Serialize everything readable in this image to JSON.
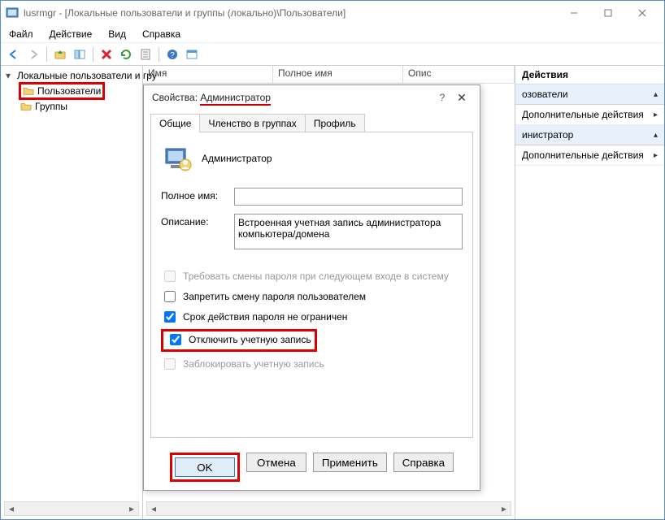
{
  "window": {
    "title": "lusrmgr - [Локальные пользователи и группы (локально)\\Пользователи]"
  },
  "menu": {
    "file": "Файл",
    "action": "Действие",
    "view": "Вид",
    "help": "Справка"
  },
  "tree": {
    "root": "Локальные пользователи и гру",
    "users": "Пользователи",
    "groups": "Группы"
  },
  "list_headers": {
    "name": "Имя",
    "full_name": "Полное имя",
    "desc": "Опис"
  },
  "actions": {
    "title": "Действия",
    "section1": "озователи",
    "more1": "Дополнительные действия",
    "section2": "инистратор",
    "more2": "Дополнительные действия"
  },
  "dialog": {
    "title_prefix": "Свойства:",
    "title_name": "Администратор",
    "tabs": {
      "general": "Общие",
      "membership": "Членство в группах",
      "profile": "Профиль"
    },
    "user_name": "Администратор",
    "full_name_label": "Полное имя:",
    "full_name_value": "",
    "desc_label": "Описание:",
    "desc_value": "Встроенная учетная запись администратора компьютера/домена",
    "chk_force_change": "Требовать смены пароля при следующем входе в систему",
    "chk_no_change": "Запретить смену пароля пользователем",
    "chk_never_expire": "Срок действия пароля не ограничен",
    "chk_disable": "Отключить учетную запись",
    "chk_locked": "Заблокировать учетную запись",
    "btn_ok": "OK",
    "btn_cancel": "Отмена",
    "btn_apply": "Применить",
    "btn_help": "Справка"
  }
}
